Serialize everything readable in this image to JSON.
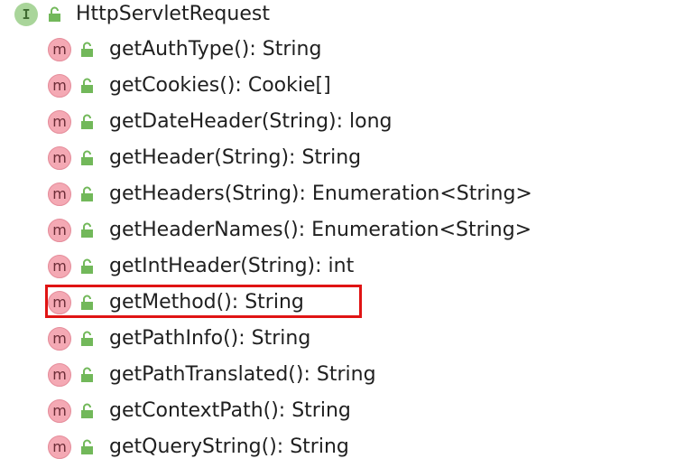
{
  "interface": {
    "icon": "interface-icon",
    "icon_letter": "I",
    "name": "HttpServletRequest"
  },
  "method_icon_letter": "m",
  "methods": [
    {
      "signature": "getAuthType(): String"
    },
    {
      "signature": "getCookies(): Cookie[]"
    },
    {
      "signature": "getDateHeader(String): long"
    },
    {
      "signature": "getHeader(String): String"
    },
    {
      "signature": "getHeaders(String): Enumeration<String>"
    },
    {
      "signature": "getHeaderNames(): Enumeration<String>"
    },
    {
      "signature": "getIntHeader(String): int"
    },
    {
      "signature": "getMethod(): String",
      "highlighted": true
    },
    {
      "signature": "getPathInfo(): String"
    },
    {
      "signature": "getPathTranslated(): String"
    },
    {
      "signature": "getContextPath(): String"
    },
    {
      "signature": "getQueryString(): String"
    }
  ],
  "colors": {
    "interface_icon_bg": "#a9d59a",
    "method_icon_bg": "#f4a9b4",
    "lock_green": "#72b85a",
    "highlight_border": "#e01414"
  }
}
